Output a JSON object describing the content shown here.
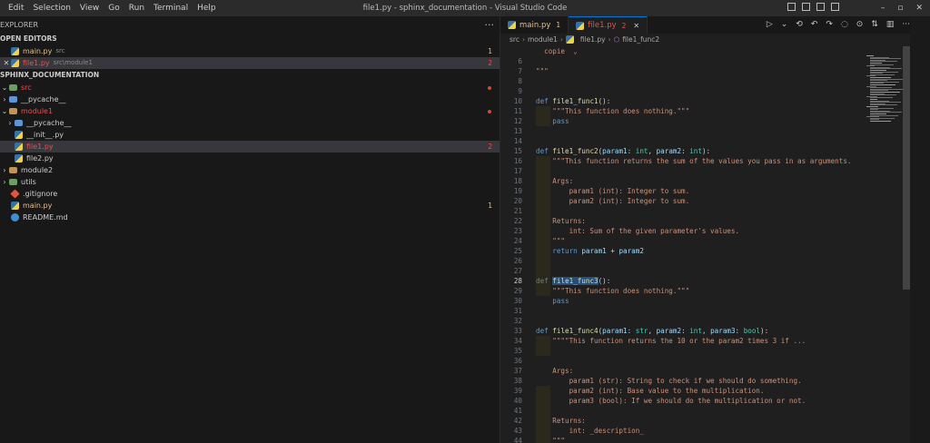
{
  "titlebar": {
    "menu": [
      "Edit",
      "Selection",
      "View",
      "Go",
      "Run",
      "Terminal",
      "Help"
    ],
    "title": "file1.py - sphinx_documentation - Visual Studio Code",
    "controls": {
      "minimize": "–",
      "restore": "▫",
      "close": "✕"
    }
  },
  "sidebar": {
    "header": "EXPLORER",
    "more": "···",
    "open_editors_title": "OPEN EDITORS",
    "open_editors": [
      {
        "name": "main.py",
        "desc": "src",
        "badge": "1"
      },
      {
        "name": "file1.py",
        "desc": "src\\module1",
        "badge": "2",
        "close": "✕"
      }
    ],
    "workspace_title": "SPHINX_DOCUMENTATION",
    "tree": [
      {
        "label": "src",
        "chev": "⌄"
      },
      {
        "label": "__pycache__",
        "chev": "›"
      },
      {
        "label": "module1",
        "chev": "⌄"
      },
      {
        "label": "__pycache__",
        "chev": "›"
      },
      {
        "label": "__init__.py"
      },
      {
        "label": "file1.py",
        "badge": "2"
      },
      {
        "label": "file2.py"
      },
      {
        "label": "module2",
        "chev": "›"
      },
      {
        "label": "utils",
        "chev": "›"
      },
      {
        "label": ".gitignore"
      },
      {
        "label": "main.py",
        "badge": "1"
      },
      {
        "label": "README.md"
      }
    ]
  },
  "editor": {
    "tabs": [
      {
        "name": "main.py",
        "count": "1"
      },
      {
        "name": "file1.py",
        "count": "2"
      }
    ],
    "tab_close": "✕",
    "actions": [
      "▷",
      "⌄",
      "⟲",
      "↶",
      "↷",
      "◌",
      "⊙",
      "⇅",
      "▥",
      "···"
    ],
    "breadcrumb": [
      "src",
      "module1",
      "file1.py",
      "file1_func2"
    ],
    "breadcrumb_sep": "›",
    "lines": [
      {
        "n": "",
        "t": "  copie  ⌄"
      },
      {
        "n": "6",
        "t": ""
      },
      {
        "n": "7",
        "t": "\"\"\""
      },
      {
        "n": "8",
        "t": ""
      },
      {
        "n": "9",
        "t": ""
      },
      {
        "n": "10",
        "t": "def file1_func1():"
      },
      {
        "n": "11",
        "t": "    \"\"\"This function does nothing.\"\"\""
      },
      {
        "n": "12",
        "t": "    pass"
      },
      {
        "n": "13",
        "t": ""
      },
      {
        "n": "14",
        "t": ""
      },
      {
        "n": "15",
        "t": "def file1_func2(param1: int, param2: int):"
      },
      {
        "n": "16",
        "t": "    \"\"\"This function returns the sum of the values you pass in as arguments."
      },
      {
        "n": "17",
        "t": ""
      },
      {
        "n": "18",
        "t": "    Args:"
      },
      {
        "n": "19",
        "t": "        param1 (int): Integer to sum."
      },
      {
        "n": "20",
        "t": "        param2 (int): Integer to sum."
      },
      {
        "n": "21",
        "t": ""
      },
      {
        "n": "22",
        "t": "    Returns:"
      },
      {
        "n": "23",
        "t": "        int: Sum of the given parameter's values."
      },
      {
        "n": "24",
        "t": "    \"\"\""
      },
      {
        "n": "25",
        "t": "    return param1 + param2"
      },
      {
        "n": "26",
        "t": ""
      },
      {
        "n": "27",
        "t": ""
      },
      {
        "n": "28",
        "t": "def file1_func3():"
      },
      {
        "n": "29",
        "t": "    \"\"\"This function does nothing.\"\"\""
      },
      {
        "n": "30",
        "t": "    pass"
      },
      {
        "n": "31",
        "t": ""
      },
      {
        "n": "32",
        "t": ""
      },
      {
        "n": "33",
        "t": "def file1_func4(param1: str, param2: int, param3: bool):"
      },
      {
        "n": "34",
        "t": "    \"\"\"\"This function returns the 10 or the param2 times 3 if ..."
      },
      {
        "n": "35",
        "t": ""
      },
      {
        "n": "36",
        "t": ""
      },
      {
        "n": "37",
        "t": "    Args:"
      },
      {
        "n": "38",
        "t": "        param1 (str): String to check if we should do something."
      },
      {
        "n": "39",
        "t": "        param2 (int): Base value to the multiplication."
      },
      {
        "n": "40",
        "t": "        param3 (bool): If we should do the multiplication or not."
      },
      {
        "n": "41",
        "t": ""
      },
      {
        "n": "42",
        "t": "    Returns:"
      },
      {
        "n": "43",
        "t": "        int: _description_"
      },
      {
        "n": "44",
        "t": "    \"\"\""
      }
    ]
  },
  "colors": {
    "keyword": "#569cd6",
    "function": "#dcdcaa",
    "param": "#9cdcfe",
    "type": "#4ec9b0",
    "string": "#ce9178",
    "accent": "#0078d4",
    "error": "#f14c4c",
    "warning": "#e2c08d"
  }
}
